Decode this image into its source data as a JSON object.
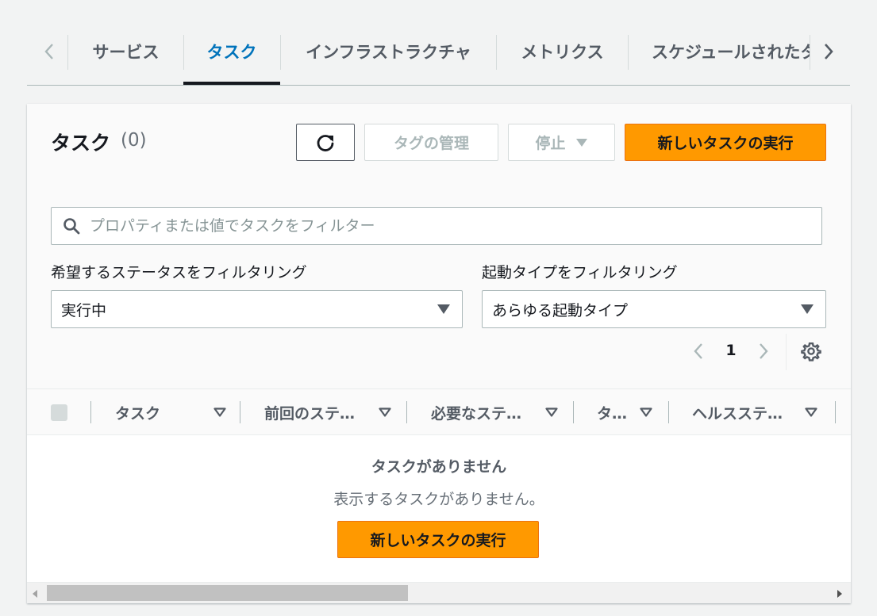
{
  "tabs": {
    "items": [
      {
        "label": "サービス"
      },
      {
        "label": "タスク"
      },
      {
        "label": "インフラストラクチャ"
      },
      {
        "label": "メトリクス"
      },
      {
        "label": "スケジュールされたタスク"
      }
    ],
    "active": "タスク"
  },
  "panel": {
    "title": "タスク",
    "count": "(0)",
    "buttons": {
      "manage_tags": "タグの管理",
      "stop": "停止",
      "run_task": "新しいタスクの実行"
    },
    "search": {
      "placeholder": "プロパティまたは値でタスクをフィルター",
      "value": ""
    },
    "filters": {
      "desired_status_label": "希望するステータスをフィルタリング",
      "desired_status_value": "実行中",
      "launch_type_label": "起動タイプをフィルタリング",
      "launch_type_value": "あらゆる起動タイプ"
    },
    "pagination": {
      "current_page": "1"
    }
  },
  "table": {
    "columns": [
      {
        "label": "タスク"
      },
      {
        "label": "前回のステ…"
      },
      {
        "label": "必要なステ…"
      },
      {
        "label": "タ…"
      },
      {
        "label": "ヘルスステ…"
      }
    ]
  },
  "empty_state": {
    "title": "タスクがありません",
    "description": "表示するタスクがありません。",
    "button": "新しいタスクの実行"
  },
  "colors": {
    "accent": "#0073bb",
    "primary_button": "#ff9900",
    "text": "#16191f",
    "muted": "#687078"
  }
}
